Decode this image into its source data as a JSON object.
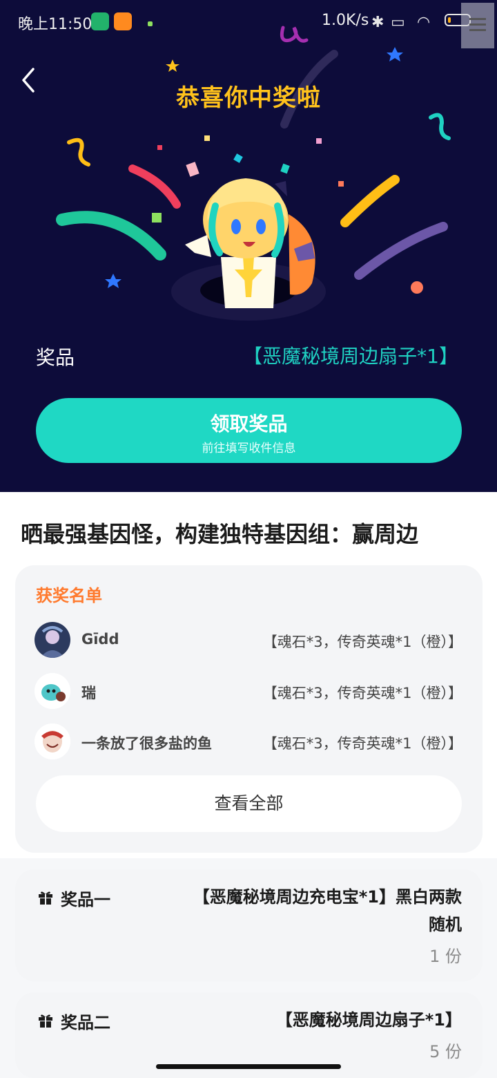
{
  "status_bar": {
    "time": "晚上11:50",
    "net_speed": "1.0K/s"
  },
  "header": {
    "title": "恭喜你中奖啦"
  },
  "prize": {
    "label": "奖品",
    "value": "【恶魔秘境周边扇子*1】"
  },
  "claim": {
    "main_label": "领取奖品",
    "sub_label": "前往填写收件信息"
  },
  "activity": {
    "title": "晒最强基因怪，构建独特基因组：赢周边"
  },
  "winners": {
    "title": "获奖名单",
    "rows": [
      {
        "name": "Gīdd",
        "prize": "【魂石*3，传奇英魂*1（橙）】"
      },
      {
        "name": "瑞",
        "prize": "【魂石*3，传奇英魂*1（橙）】"
      },
      {
        "name": "一条放了很多盐的鱼",
        "prize": "【魂石*3，传奇英魂*1（橙）】"
      }
    ],
    "view_all": "查看全部"
  },
  "prizes": [
    {
      "name": "奖品一",
      "desc_line1": "【恶魔秘境周边充电宝*1】黑白两款",
      "desc_line2": "随机",
      "count": "1 份"
    },
    {
      "name": "奖品二",
      "desc_line1": "【恶魔秘境周边扇子*1】",
      "count": "5 份"
    }
  ],
  "colors": {
    "hero_bg": "#0d0c3a",
    "accent_teal": "#1fd8c4",
    "title_gold": "#ffc21c",
    "winners_orange": "#ff7a2e"
  }
}
